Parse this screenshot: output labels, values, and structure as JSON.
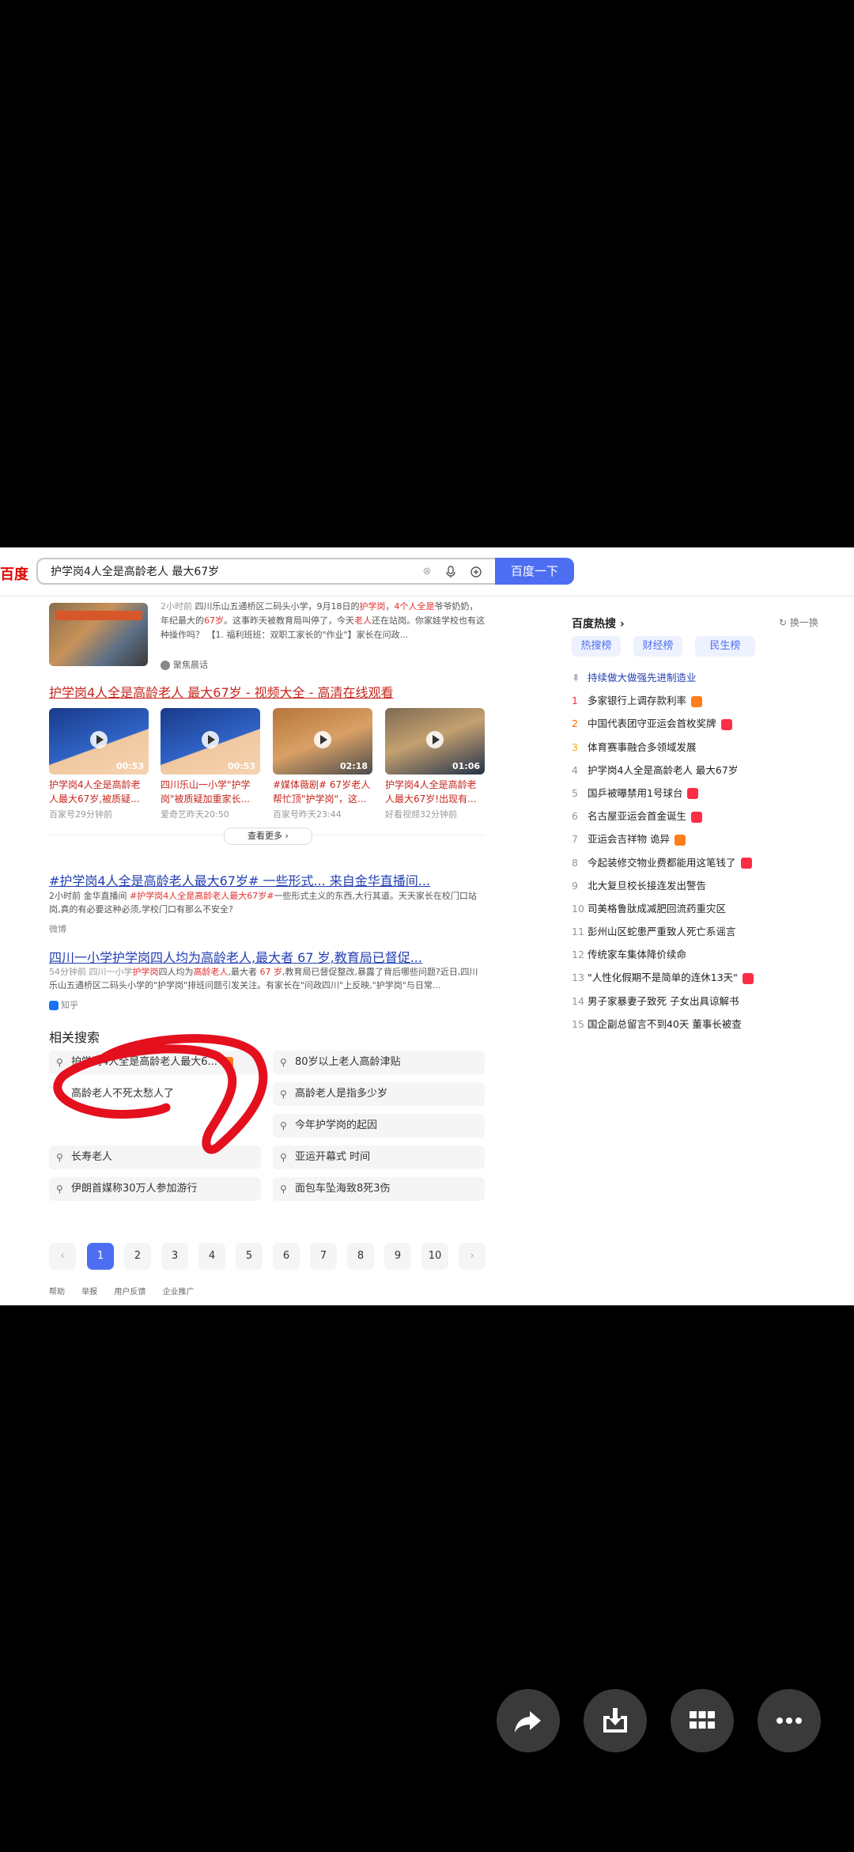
{
  "topbar": {
    "logo": "百度",
    "query": "护学岗4人全是高龄老人 最大67岁",
    "search_button": "百度一下"
  },
  "results": {
    "first": {
      "time": "2小时前",
      "snippet_a": " 四川乐山五通桥区二码头小学，9月18日的",
      "kw1": "护学岗",
      "snippet_b": "，",
      "kw2": "4个人全是",
      "snippet_c": "爷爷奶奶，年纪最大的",
      "kw3": "67岁",
      "snippet_d": "。这事昨天被教育局叫停了，今天",
      "kw4": "老人",
      "snippet_e": "还在站岗。你家娃学校也有这种操作吗？ 【1. 福利班班：双职工家长的\"作业\"】家长在问政...",
      "source": "聚焦晨话"
    },
    "video": {
      "title": "护学岗4人全是高龄老人 最大67岁 - 视频大全 - 高清在线观看",
      "cards": [
        {
          "duration": "00:53",
          "caption": "护学岗4人全是高龄老人最大67岁,被质疑...",
          "meta": "百家号29分钟前"
        },
        {
          "duration": "00:53",
          "caption": "四川乐山一小学\"护学岗\"被质疑加重家长...",
          "meta": "爱奇艺昨天20:50"
        },
        {
          "duration": "02:18",
          "caption": "#媒体薇剧# 67岁老人帮忙顶\"护学岗\"，这...",
          "meta": "百家号昨天23:44"
        },
        {
          "duration": "01:06",
          "caption": "护学岗4人全是高龄老人最大67岁!出现有...",
          "meta": "好看视频32分钟前"
        }
      ],
      "more": "查看更多 ›"
    },
    "third": {
      "title": "#护学岗4人全是高龄老人最大67岁# 一些形式... 来自金华直播间...",
      "text_a": "2小时前 金华直播间 ",
      "text_kw": "#护学岗4人全是高龄老人最大67岁#",
      "text_b": "一些形式主义的东西,大行其道。天天家长在校门口站岗,真的有必要这种必须,学校门口有那么不安全?",
      "source": "微博"
    },
    "fourth": {
      "title": "四川一小学护学岗四人均为高龄老人,最大者 67 岁,教育局已督促...",
      "text_a": "54分钟前 四川一小学",
      "text_kw1": "护学岗",
      "text_b": "四人均为",
      "text_kw2": "高龄老人",
      "text_c": ",最大者 ",
      "text_kw3": "67 岁",
      "text_d": ",教育局已督促整改,暴露了背后哪些问题?近日,四川乐山五通桥区二码头小学的\"护学岗\"排班问题引发关注。有家长在\"问政四川\"上反映,\"护学岗\"与日常...",
      "source": "知乎"
    }
  },
  "related": {
    "heading": "相关搜索",
    "items": [
      "护学岗4人全是高龄老人最大6...",
      "80岁以上老人高龄津贴",
      "高龄老人不死太愁人了",
      "高龄老人是指多少岁",
      "今年护学岗的起因",
      "长寿老人",
      "亚运开幕式 时间",
      "伊朗首媒称30万人参加游行",
      "面包车坠海致8死3伤"
    ]
  },
  "pagination": {
    "prev": "‹",
    "pages": [
      "1",
      "2",
      "3",
      "4",
      "5",
      "6",
      "7",
      "8",
      "9",
      "10"
    ],
    "next": "›"
  },
  "footer": [
    "帮助",
    "举报",
    "用户反馈",
    "企业推广"
  ],
  "hot": {
    "title": "百度热搜 ›",
    "refresh": "换一换",
    "tabs": [
      "热搜榜",
      "财经榜",
      "民生榜"
    ],
    "items": [
      {
        "num": "",
        "text": "持续做大做强先进制造业",
        "tag": ""
      },
      {
        "num": "1",
        "text": "多家银行上调存款利率",
        "tag": "hot"
      },
      {
        "num": "2",
        "text": "中国代表团守亚运会首枚奖牌",
        "tag": "new"
      },
      {
        "num": "3",
        "text": "体育赛事融合多领域发展",
        "tag": ""
      },
      {
        "num": "4",
        "text": "护学岗4人全是高龄老人 最大67岁",
        "tag": ""
      },
      {
        "num": "5",
        "text": "国乒被曝禁用1号球台",
        "tag": "new"
      },
      {
        "num": "6",
        "text": "名古屋亚运会首金诞生",
        "tag": "new"
      },
      {
        "num": "7",
        "text": "亚运会吉祥物 诡异",
        "tag": "hot"
      },
      {
        "num": "8",
        "text": "今起装修交物业费都能用这笔钱了",
        "tag": "new"
      },
      {
        "num": "9",
        "text": "北大复旦校长接连发出警告",
        "tag": ""
      },
      {
        "num": "10",
        "text": "司美格鲁肽成减肥回流药重灾区",
        "tag": ""
      },
      {
        "num": "11",
        "text": "彭州山区蛇患严重致人死亡系谣言",
        "tag": ""
      },
      {
        "num": "12",
        "text": "传统家车集体降价续命",
        "tag": ""
      },
      {
        "num": "13",
        "text": "\"人性化假期不是简单的连休13天\"",
        "tag": "new"
      },
      {
        "num": "14",
        "text": "男子家暴妻子致死 子女出具谅解书",
        "tag": ""
      },
      {
        "num": "15",
        "text": "国企副总留言不到40天 董事长被查",
        "tag": ""
      }
    ]
  },
  "actions": [
    "share-icon",
    "save-icon",
    "apps-icon",
    "more-icon"
  ],
  "colors": {
    "accent": "#4e6ef2",
    "link": "#2440b3",
    "keyword": "#e0322e",
    "annotation": "#e4101e"
  }
}
